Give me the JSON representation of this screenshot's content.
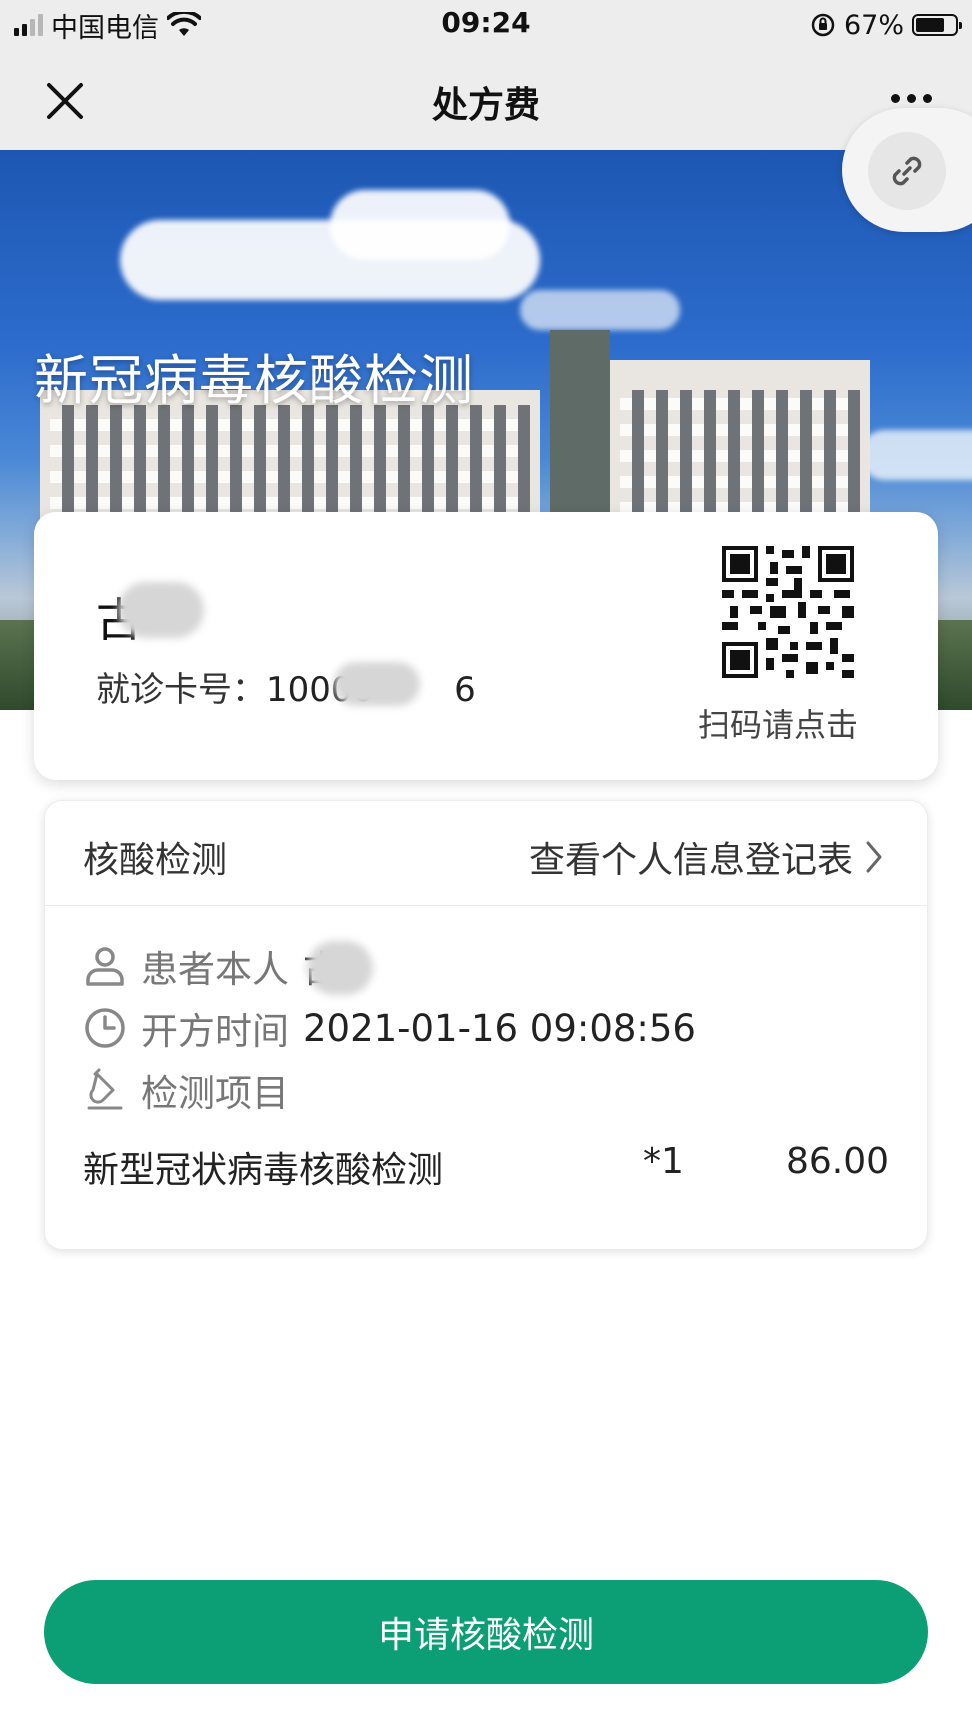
{
  "status_bar": {
    "carrier": "中国电信",
    "time": "09:24",
    "battery_percent": "67%",
    "battery_level": 0.67
  },
  "nav": {
    "title": "处方费"
  },
  "banner": {
    "title": "新冠病毒核酸检测"
  },
  "patient_card": {
    "name": "古",
    "card_no_label": "就诊卡号：",
    "card_no": "10000",
    "card_no_tail": "6",
    "qr_caption": "扫码请点击"
  },
  "order": {
    "type": "核酸检测",
    "view_link": "查看个人信息登记表",
    "patient_label": "患者本人",
    "patient_name": "古",
    "time_label": "开方时间",
    "time_value": "2021-01-16 09:08:56",
    "items_label": "检测项目",
    "items": [
      {
        "name": "新型冠状病毒核酸检测",
        "qty": "*1",
        "price": "86.00"
      }
    ]
  },
  "actions": {
    "apply_label": "申请核酸检测"
  },
  "colors": {
    "accent": "#0c9e74",
    "nav_bg": "#ededed"
  },
  "icons": [
    "close-icon",
    "more-icon",
    "link-icon",
    "qr-code-icon",
    "person-icon",
    "clock-icon",
    "test-tube-icon",
    "chevron-right-icon",
    "wifi-icon",
    "battery-icon",
    "signal-icon",
    "orientation-lock-icon"
  ]
}
